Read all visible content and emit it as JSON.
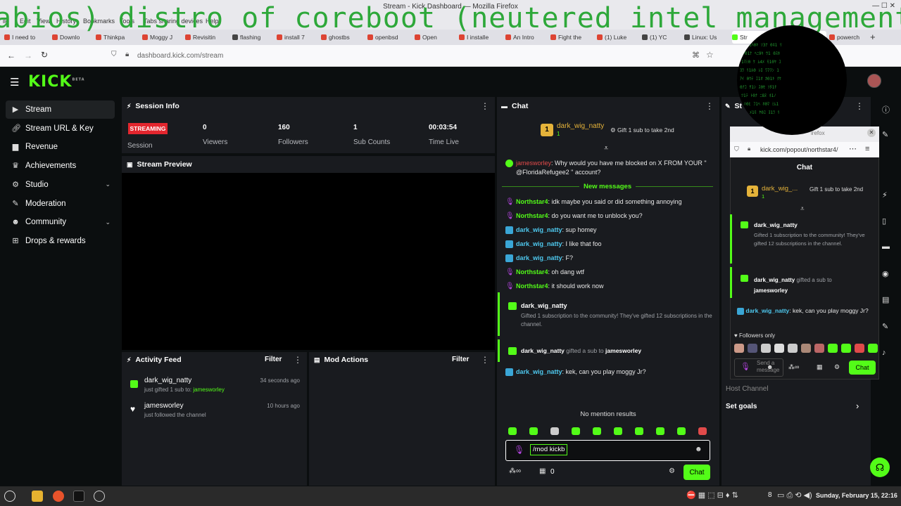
{
  "firefox": {
    "title": "Stream - Kick Dashboard — Mozilla Firefox",
    "menu": [
      "ile",
      "Edit",
      "View",
      "History",
      "Bookmarks",
      "Tools",
      "Tabs sharing devices",
      "Help"
    ],
    "tabs": [
      "I need to",
      "Downlo",
      "Thinkpa",
      "Moggy J",
      "Revisitin",
      "flashing",
      "install 7",
      "ghostbs",
      "openbsd",
      "Open",
      "I installe",
      "An Intro",
      "Fight the",
      "(1) Luke",
      "(1) YC",
      "Linux: Us",
      "Str",
      "powerch"
    ],
    "url": "dashboard.kick.com/stream",
    "overlay_text": "abios) distro of coreboot (neutered intel management"
  },
  "kick": {
    "logo": "KICK",
    "logo_sup": "BETA",
    "sidebar": [
      {
        "label": "Stream",
        "icon": "stream-icon"
      },
      {
        "label": "Stream URL & Key",
        "icon": "link-icon"
      },
      {
        "label": "Revenue",
        "icon": "chart-icon"
      },
      {
        "label": "Achievements",
        "icon": "trophy-icon"
      },
      {
        "label": "Studio",
        "icon": "gear-icon"
      },
      {
        "label": "Moderation",
        "icon": "wrench-icon"
      },
      {
        "label": "Community",
        "icon": "people-icon"
      },
      {
        "label": "Drops & rewards",
        "icon": "gift-icon"
      }
    ],
    "session": {
      "title": "Session Info",
      "status": "STREAMING",
      "status_label": "Session",
      "stats": [
        {
          "value": "0",
          "label": "Viewers"
        },
        {
          "value": "160",
          "label": "Followers"
        },
        {
          "value": "1",
          "label": "Sub Counts"
        },
        {
          "value": "00:03:54",
          "label": "Time Live"
        }
      ]
    },
    "preview_title": "Stream Preview",
    "activity": {
      "title": "Activity Feed",
      "filter": "Filter",
      "items": [
        {
          "user": "dark_wig_natty",
          "text": "just gifted 1 sub to:",
          "target": "jamesworley",
          "time": "34 seconds ago"
        },
        {
          "user": "jamesworley",
          "text": "just followed the channel",
          "target": "",
          "time": "10 hours ago"
        }
      ]
    },
    "mod_actions": {
      "title": "Mod Actions",
      "filter": "Filter"
    },
    "chat": {
      "title": "Chat",
      "pinned_user": "dark_wig_natty",
      "pinned_count": "1",
      "gift_text": "Gift 1 sub to take 2nd",
      "first_msg_user": "jamesworley",
      "first_msg_text": ": Why would you have me blocked on X FROM YOUR \" @FloridaRefugee2 \" account?",
      "new_messages": "New messages",
      "messages": [
        {
          "user": "Northstar4",
          "text": ": idk maybe you said or did something annoying",
          "color": "g"
        },
        {
          "user": "Northstar4",
          "text": ": do you want me to unblock you?",
          "color": "g"
        },
        {
          "user": "dark_wig_natty",
          "text": ": sup homey",
          "color": "b"
        },
        {
          "user": "dark_wig_natty",
          "text": ": I like that foo",
          "color": "b"
        },
        {
          "user": "dark_wig_natty",
          "text": ": F?",
          "color": "b"
        },
        {
          "user": "Northstar4",
          "text": ": oh dang wtf",
          "color": "g"
        },
        {
          "user": "Northstar4",
          "text": ": it should work now",
          "color": "g"
        }
      ],
      "gift_event_user": "dark_wig_natty",
      "gift_event_text": "Gifted 1 subscription to the community! They've gifted 12 subscriptions in the channel.",
      "gifted_sub_user": "dark_wig_natty",
      "gifted_sub_text": "gifted a sub to",
      "gifted_sub_target": "jamesworley",
      "last_msg_user": "dark_wig_natty",
      "last_msg_text": ": kek, can you play moggy Jr?",
      "no_mentions": "No mention results",
      "input_value": "/mod kickb",
      "count": "0",
      "chat_button": "Chat"
    },
    "popout": {
      "browser_title": "irefox",
      "url": "kick.com/popout/northstar4/",
      "chat_title": "Chat",
      "pinned_user": "dark_wig_...",
      "pinned_count": "1",
      "gift_text": "Gift 1 sub to take 2nd",
      "event_user": "dark_wig_natty",
      "event_text": "Gifted 1 subscription to the community! They've gifted 12 subscriptions in the channel.",
      "gift_user": "dark_wig_natty",
      "gift_text2": "gifted a sub to",
      "gift_target": "jamesworley",
      "msg_user": "dark_wig_natty",
      "msg_text": ": kek, can you play moggy Jr?",
      "followers_only": "Followers only",
      "placeholder": "Send a message",
      "chat_button": "Chat"
    },
    "right_panel": {
      "title": "St",
      "host_channel": "Host Channel",
      "set_goals": "Set goals"
    }
  },
  "taskbar": {
    "clock": "Sunday, February 15, 22:16",
    "badge": "8"
  }
}
